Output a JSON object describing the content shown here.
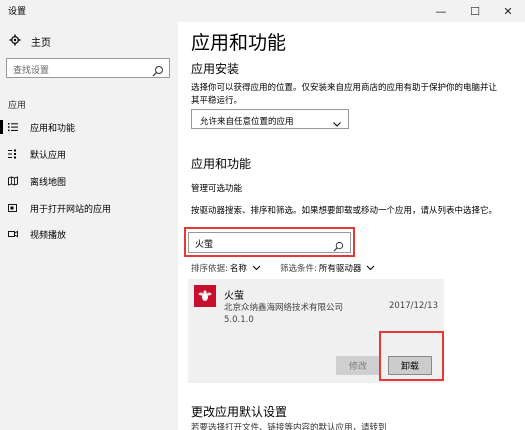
{
  "window": {
    "title": "设置",
    "minimize_glyph": "—",
    "maximize_glyph": "☐",
    "close_glyph": "✕"
  },
  "sidebar": {
    "home_label": "主页",
    "search_placeholder": "查找设置",
    "section_label": "应用",
    "items": [
      {
        "label": "应用和功能",
        "icon": "list-icon",
        "active": true
      },
      {
        "label": "默认应用",
        "icon": "default-apps-icon",
        "active": false
      },
      {
        "label": "离线地图",
        "icon": "map-icon",
        "active": false
      },
      {
        "label": "用于打开网站的应用",
        "icon": "open-with-icon",
        "active": false
      },
      {
        "label": "视频播放",
        "icon": "video-icon",
        "active": false
      }
    ]
  },
  "main": {
    "title": "应用和功能",
    "install_heading": "应用安装",
    "install_desc": "选择你可以获得应用的位置。仅安装来自应用商店的应用有助于保护你的电脑并让其平稳运行。",
    "install_option": "允许来自任意位置的应用",
    "apps_heading": "应用和功能",
    "manage_optional_link": "管理可选功能",
    "search_desc": "按驱动器搜索、排序和筛选。如果想要卸载或移动一个应用，请从列表中选择它。",
    "search_value": "火萤",
    "sort_label": "排序依据:",
    "sort_value": "名称",
    "filter_label": "筛选条件:",
    "filter_value": "所有驱动器",
    "app": {
      "name": "火萤",
      "publisher": "北京众纳鑫海网络技术有限公司",
      "version": "5.0.1.0",
      "date": "2017/12/13",
      "modify_label": "修改",
      "uninstall_label": "卸载"
    },
    "defaults_heading": "更改应用默认设置",
    "defaults_desc": "若要选择打开文件、链接等内容的默认应用，请转到"
  },
  "colors": {
    "highlight": "#e53935",
    "app_icon_bg": "#c8102e",
    "sidebar_bg": "#f2f2f2"
  }
}
